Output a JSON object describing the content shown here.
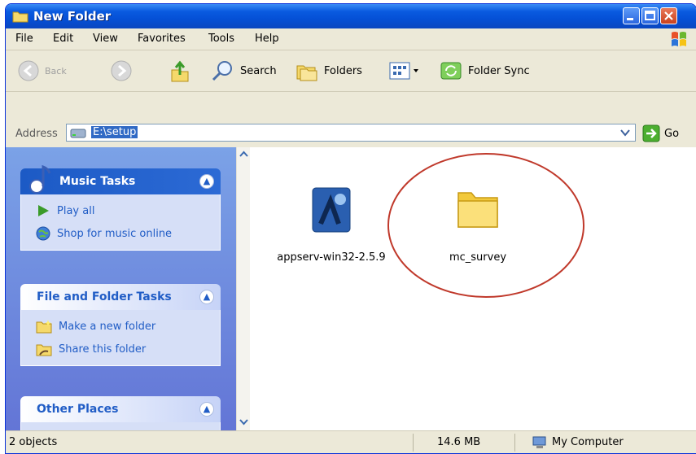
{
  "window": {
    "title": "New Folder"
  },
  "menubar": {
    "items": [
      "File",
      "Edit",
      "View",
      "Favorites",
      "Tools",
      "Help"
    ]
  },
  "toolbar": {
    "back_label": "Back",
    "search_label": "Search",
    "folders_label": "Folders",
    "sync_label": "Folder Sync"
  },
  "address": {
    "label": "Address",
    "value": "E:\\setup",
    "go_label": "Go"
  },
  "left_pane": {
    "music_tasks": {
      "title": "Music Tasks",
      "items": [
        {
          "label": "Play all",
          "icon": "play-icon"
        },
        {
          "label": "Shop for music online",
          "icon": "globe-icon"
        }
      ]
    },
    "file_folder_tasks": {
      "title": "File and Folder Tasks",
      "items": [
        {
          "label": "Make a new folder",
          "icon": "new-folder-icon"
        },
        {
          "label": "Share this folder",
          "icon": "share-folder-icon"
        }
      ]
    },
    "other_places": {
      "title": "Other Places"
    }
  },
  "files": [
    {
      "name": "appserv-win32-2.5.9",
      "icon": "installer-icon"
    },
    {
      "name": "mc_survey",
      "icon": "folder-icon"
    }
  ],
  "status": {
    "objects": "2 objects",
    "size": "14.6 MB",
    "location": "My Computer"
  },
  "colors": {
    "titlebar": "#0550d6",
    "task_link": "#215dc6",
    "highlight_circle": "#c0392b",
    "address_selection": "#316ac5"
  }
}
